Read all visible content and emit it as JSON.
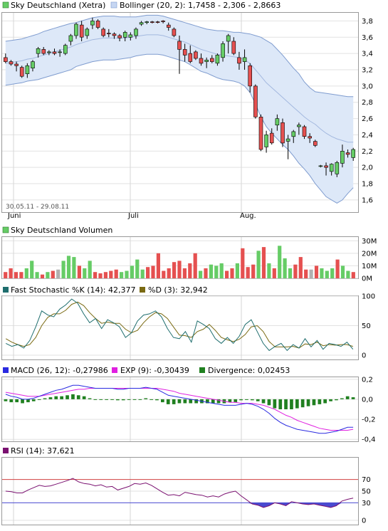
{
  "colors": {
    "up": "#66cc66",
    "down": "#e55050",
    "neutral": "#b0b0b0",
    "band_fill": "#dde8f8",
    "band_line": "#7f9ccf",
    "stoch_k": "#1f6e6e",
    "stoch_d": "#7a6a12",
    "macd": "#2a2ae0",
    "exp": "#e020e0",
    "divergence": "#208020",
    "rsi": "#7a1070",
    "rsi_over": "#4a4ad0",
    "overbought": "#d04040"
  },
  "price_panel": {
    "legend_primary": "Sky Deutschland (Xetra)",
    "legend_bollinger": "Bollinger (20, 2): 1,7458 - 2,306 - 2,8663",
    "date_range": "30.05.11 - 29.08.11",
    "month_labels": [
      "Juni",
      "Juli",
      "Aug."
    ],
    "y_ticks": [
      "3,8",
      "3,6",
      "3,4",
      "3,2",
      "3,0",
      "2,8",
      "2,6",
      "2,4",
      "2,2",
      "2,0",
      "1,8",
      "1,6"
    ]
  },
  "volume_panel": {
    "legend": "Sky Deutschland Volumen",
    "y_ticks": [
      "30M",
      "20M",
      "10M",
      "0M"
    ]
  },
  "stoch_panel": {
    "legend_k": "Fast Stochastic %K (14): 42,377",
    "legend_d": "%D (3): 32,942",
    "y_ticks": [
      "100",
      "50",
      "0"
    ]
  },
  "macd_panel": {
    "legend_macd": "MACD (26, 12): -0,27986",
    "legend_exp": "EXP (9): -0,30439",
    "legend_div": "Divergence: 0,02453",
    "y_ticks": [
      "0,2",
      "0,0",
      "-0,2",
      "-0,4"
    ]
  },
  "rsi_panel": {
    "legend": "RSI (14): 37,621",
    "y_ticks": [
      "70",
      "50",
      "30",
      "0"
    ]
  },
  "chart_data": [
    {
      "type": "candlestick",
      "title": "Sky Deutschland (Xetra)",
      "x": [
        "Jun",
        "Jun",
        "Jun",
        "Jun",
        "Jun",
        "Jun",
        "Jun",
        "Jun",
        "Jun",
        "Jun",
        "Jun",
        "Jun",
        "Jun",
        "Jun",
        "Jun",
        "Jun",
        "Jun",
        "Jun",
        "Jun",
        "Jun",
        "Jun",
        "Jun",
        "Jul",
        "Jul",
        "Jul",
        "Jul",
        "Jul",
        "Jul",
        "Jul",
        "Jul",
        "Jul",
        "Jul",
        "Jul",
        "Jul",
        "Jul",
        "Jul",
        "Jul",
        "Jul",
        "Jul",
        "Jul",
        "Jul",
        "Jul",
        "Jul",
        "Aug",
        "Aug",
        "Aug",
        "Aug",
        "Aug",
        "Aug",
        "Aug",
        "Aug",
        "Aug",
        "Aug",
        "Aug",
        "Aug",
        "Aug",
        "Aug",
        "Aug",
        "Aug",
        "Aug",
        "Aug",
        "Aug",
        "Aug",
        "Aug",
        "Aug"
      ],
      "ohlc": [
        [
          3.35,
          3.4,
          3.28,
          3.3
        ],
        [
          3.3,
          3.32,
          3.25,
          3.27
        ],
        [
          3.27,
          3.3,
          3.18,
          3.25
        ],
        [
          3.23,
          3.25,
          3.1,
          3.12
        ],
        [
          3.15,
          3.28,
          3.1,
          3.25
        ],
        [
          3.22,
          3.32,
          3.18,
          3.3
        ],
        [
          3.4,
          3.48,
          3.35,
          3.46
        ],
        [
          3.45,
          3.48,
          3.38,
          3.4
        ],
        [
          3.41,
          3.44,
          3.38,
          3.42
        ],
        [
          3.42,
          3.46,
          3.38,
          3.4
        ],
        [
          3.42,
          3.45,
          3.36,
          3.42
        ],
        [
          3.4,
          3.52,
          3.38,
          3.5
        ],
        [
          3.55,
          3.64,
          3.5,
          3.62
        ],
        [
          3.62,
          3.78,
          3.58,
          3.76
        ],
        [
          3.75,
          3.8,
          3.55,
          3.6
        ],
        [
          3.62,
          3.72,
          3.58,
          3.7
        ],
        [
          3.75,
          3.84,
          3.7,
          3.8
        ],
        [
          3.8,
          3.82,
          3.7,
          3.72
        ],
        [
          3.7,
          3.72,
          3.6,
          3.62
        ],
        [
          3.65,
          3.7,
          3.6,
          3.64
        ],
        [
          3.64,
          3.66,
          3.58,
          3.62
        ],
        [
          3.62,
          3.64,
          3.55,
          3.59
        ],
        [
          3.6,
          3.68,
          3.55,
          3.66
        ],
        [
          3.6,
          3.66,
          3.56,
          3.63
        ],
        [
          3.62,
          3.72,
          3.58,
          3.7
        ],
        [
          3.76,
          3.8,
          3.74,
          3.78
        ],
        [
          3.78,
          3.8,
          3.76,
          3.79
        ],
        [
          3.79,
          3.8,
          3.77,
          3.78
        ],
        [
          3.79,
          3.8,
          3.77,
          3.78
        ],
        [
          3.8,
          3.81,
          3.77,
          3.79
        ],
        [
          3.75,
          3.78,
          3.68,
          3.72
        ],
        [
          3.7,
          3.72,
          3.6,
          3.62
        ],
        [
          3.55,
          3.62,
          3.15,
          3.45
        ],
        [
          3.45,
          3.52,
          3.3,
          3.38
        ],
        [
          3.4,
          3.5,
          3.28,
          3.3
        ],
        [
          3.42,
          3.44,
          3.32,
          3.34
        ],
        [
          3.34,
          3.4,
          3.25,
          3.28
        ],
        [
          3.3,
          3.35,
          3.22,
          3.32
        ],
        [
          3.34,
          3.38,
          3.28,
          3.3
        ],
        [
          3.28,
          3.4,
          3.25,
          3.38
        ],
        [
          3.35,
          3.55,
          3.3,
          3.52
        ],
        [
          3.55,
          3.64,
          3.4,
          3.62
        ],
        [
          3.55,
          3.6,
          3.38,
          3.4
        ],
        [
          3.35,
          3.42,
          3.2,
          3.28
        ],
        [
          3.3,
          3.45,
          3.2,
          3.35
        ],
        [
          3.25,
          3.28,
          2.92,
          3.0
        ],
        [
          3.0,
          3.02,
          2.6,
          2.62
        ],
        [
          2.62,
          2.65,
          2.2,
          2.22
        ],
        [
          2.25,
          2.45,
          2.18,
          2.4
        ],
        [
          2.42,
          2.48,
          2.28,
          2.3
        ],
        [
          2.52,
          2.65,
          2.45,
          2.6
        ],
        [
          2.55,
          2.6,
          2.25,
          2.3
        ],
        [
          2.32,
          2.4,
          2.1,
          2.35
        ],
        [
          2.38,
          2.46,
          2.3,
          2.44
        ],
        [
          2.5,
          2.55,
          2.4,
          2.52
        ],
        [
          2.5,
          2.52,
          2.35,
          2.38
        ],
        [
          2.38,
          2.42,
          2.3,
          2.36
        ],
        [
          2.32,
          2.34,
          2.25,
          2.27
        ],
        [
          2.02,
          2.03,
          2.0,
          2.02
        ],
        [
          2.02,
          2.06,
          1.9,
          2.0
        ],
        [
          1.95,
          2.05,
          1.9,
          2.04
        ],
        [
          1.92,
          2.08,
          1.88,
          2.06
        ],
        [
          2.05,
          2.28,
          2.0,
          2.2
        ],
        [
          2.18,
          2.22,
          2.12,
          2.16
        ],
        [
          2.12,
          2.24,
          2.08,
          2.22
        ]
      ],
      "bollinger": {
        "upper": [
          3.55,
          3.56,
          3.57,
          3.58,
          3.6,
          3.62,
          3.64,
          3.67,
          3.69,
          3.71,
          3.73,
          3.75,
          3.77,
          3.78,
          3.8,
          3.82,
          3.84,
          3.85,
          3.86,
          3.86,
          3.86,
          3.85,
          3.85,
          3.85,
          3.85,
          3.86,
          3.87,
          3.87,
          3.87,
          3.86,
          3.84,
          3.82,
          3.8,
          3.78,
          3.76,
          3.74,
          3.72,
          3.7,
          3.69,
          3.68,
          3.68,
          3.67,
          3.66,
          3.66,
          3.65,
          3.64,
          3.62,
          3.6,
          3.56,
          3.52,
          3.45,
          3.38,
          3.3,
          3.22,
          3.15,
          3.05,
          2.98,
          2.93,
          2.92,
          2.91,
          2.9,
          2.89,
          2.88,
          2.87,
          2.87
        ],
        "middle": [
          3.28,
          3.29,
          3.3,
          3.31,
          3.33,
          3.34,
          3.36,
          3.38,
          3.4,
          3.42,
          3.44,
          3.46,
          3.48,
          3.51,
          3.53,
          3.55,
          3.57,
          3.58,
          3.59,
          3.59,
          3.59,
          3.59,
          3.59,
          3.6,
          3.61,
          3.62,
          3.63,
          3.63,
          3.63,
          3.62,
          3.6,
          3.58,
          3.56,
          3.54,
          3.51,
          3.48,
          3.45,
          3.43,
          3.41,
          3.39,
          3.38,
          3.37,
          3.36,
          3.35,
          3.32,
          3.28,
          3.2,
          3.12,
          3.04,
          2.98,
          2.92,
          2.86,
          2.8,
          2.74,
          2.68,
          2.62,
          2.57,
          2.53,
          2.47,
          2.42,
          2.38,
          2.35,
          2.33,
          2.31,
          2.31
        ],
        "lower": [
          3.01,
          3.02,
          3.03,
          3.04,
          3.06,
          3.07,
          3.08,
          3.1,
          3.12,
          3.14,
          3.16,
          3.18,
          3.2,
          3.24,
          3.26,
          3.28,
          3.3,
          3.31,
          3.32,
          3.32,
          3.32,
          3.33,
          3.34,
          3.35,
          3.37,
          3.38,
          3.39,
          3.39,
          3.39,
          3.38,
          3.36,
          3.34,
          3.32,
          3.3,
          3.26,
          3.22,
          3.18,
          3.16,
          3.13,
          3.1,
          3.08,
          3.07,
          3.06,
          3.04,
          3.0,
          2.92,
          2.78,
          2.62,
          2.5,
          2.42,
          2.35,
          2.28,
          2.22,
          2.14,
          2.05,
          1.98,
          1.9,
          1.8,
          1.72,
          1.64,
          1.6,
          1.56,
          1.6,
          1.68,
          1.75
        ]
      },
      "y_range": [
        1.45,
        3.9
      ]
    },
    {
      "type": "bar",
      "title": "Sky Deutschland Volumen",
      "values": [
        5,
        8,
        5,
        5,
        8,
        14,
        5,
        3,
        5,
        6,
        7,
        14,
        18,
        17,
        10,
        8,
        14,
        5,
        4,
        5,
        6,
        7,
        5,
        6,
        10,
        15,
        7,
        9,
        10,
        20,
        6,
        8,
        13,
        14,
        8,
        12,
        20,
        6,
        8,
        11,
        10,
        12,
        6,
        8,
        12,
        24,
        9,
        11,
        22,
        25,
        12,
        8,
        26,
        16,
        8,
        11,
        17,
        7,
        7,
        10,
        8,
        6,
        8,
        15,
        10,
        6,
        5
      ]
    },
    {
      "type": "line",
      "title": "Fast Stochastic",
      "series": [
        {
          "name": "%K",
          "values": [
            20,
            15,
            18,
            12,
            25,
            48,
            75,
            68,
            65,
            78,
            85,
            95,
            88,
            70,
            55,
            62,
            45,
            60,
            55,
            48,
            30,
            38,
            58,
            68,
            70,
            75,
            65,
            45,
            30,
            28,
            40,
            22,
            58,
            52,
            45,
            28,
            20,
            30,
            20,
            32,
            52,
            60,
            40,
            20,
            8,
            15,
            20,
            8,
            18,
            12,
            28,
            14,
            25,
            10,
            20,
            18,
            15,
            22,
            10
          ]
        },
        {
          "name": "%D",
          "values": [
            28,
            22,
            18,
            15,
            18,
            30,
            50,
            64,
            70,
            70,
            76,
            86,
            90,
            84,
            72,
            62,
            54,
            56,
            54,
            54,
            44,
            38,
            42,
            55,
            65,
            72,
            70,
            62,
            48,
            34,
            33,
            30,
            40,
            44,
            52,
            42,
            30,
            26,
            23,
            27,
            35,
            48,
            50,
            40,
            23,
            14,
            14,
            14,
            15,
            12,
            19,
            18,
            22,
            16,
            18,
            17,
            18,
            18,
            15
          ]
        }
      ],
      "y_range": [
        0,
        100
      ]
    },
    {
      "type": "line",
      "title": "MACD",
      "series": [
        {
          "name": "MACD",
          "values": [
            0.05,
            0.03,
            0.02,
            0.0,
            0.0,
            0.01,
            0.03,
            0.05,
            0.07,
            0.09,
            0.1,
            0.12,
            0.14,
            0.14,
            0.13,
            0.12,
            0.11,
            0.11,
            0.11,
            0.11,
            0.1,
            0.1,
            0.11,
            0.11,
            0.11,
            0.12,
            0.11,
            0.1,
            0.07,
            0.04,
            0.03,
            0.02,
            0.01,
            0.0,
            -0.01,
            -0.02,
            -0.03,
            -0.04,
            -0.05,
            -0.06,
            -0.06,
            -0.06,
            -0.05,
            -0.04,
            -0.05,
            -0.07,
            -0.1,
            -0.14,
            -0.19,
            -0.23,
            -0.26,
            -0.28,
            -0.3,
            -0.31,
            -0.32,
            -0.33,
            -0.34,
            -0.34,
            -0.33,
            -0.32,
            -0.3,
            -0.28,
            -0.28
          ]
        },
        {
          "name": "EXP",
          "values": [
            0.07,
            0.06,
            0.05,
            0.04,
            0.03,
            0.03,
            0.03,
            0.04,
            0.05,
            0.06,
            0.07,
            0.08,
            0.09,
            0.1,
            0.1,
            0.11,
            0.11,
            0.11,
            0.11,
            0.11,
            0.11,
            0.11,
            0.11,
            0.11,
            0.11,
            0.11,
            0.11,
            0.11,
            0.1,
            0.09,
            0.08,
            0.06,
            0.05,
            0.04,
            0.03,
            0.02,
            0.01,
            0.0,
            -0.01,
            -0.02,
            -0.03,
            -0.03,
            -0.04,
            -0.04,
            -0.04,
            -0.05,
            -0.06,
            -0.08,
            -0.1,
            -0.13,
            -0.16,
            -0.18,
            -0.21,
            -0.23,
            -0.25,
            -0.27,
            -0.29,
            -0.3,
            -0.31,
            -0.31,
            -0.31,
            -0.31,
            -0.3
          ]
        },
        {
          "name": "Divergence",
          "values": [
            -0.02,
            -0.03,
            -0.03,
            -0.04,
            -0.03,
            -0.02,
            0.0,
            0.01,
            0.02,
            0.03,
            0.03,
            0.04,
            0.05,
            0.04,
            0.03,
            0.01,
            0.0,
            0.0,
            0.0,
            0.0,
            -0.01,
            -0.01,
            0.0,
            0.0,
            0.0,
            0.01,
            0.0,
            -0.01,
            -0.03,
            -0.05,
            -0.05,
            -0.04,
            -0.04,
            -0.04,
            -0.04,
            -0.04,
            -0.04,
            -0.04,
            -0.04,
            -0.04,
            -0.03,
            -0.03,
            -0.01,
            0.0,
            -0.01,
            -0.02,
            -0.04,
            -0.06,
            -0.09,
            -0.1,
            -0.1,
            -0.1,
            -0.09,
            -0.08,
            -0.07,
            -0.06,
            -0.05,
            -0.04,
            -0.02,
            -0.01,
            0.01,
            0.03,
            0.02
          ]
        }
      ],
      "y_range": [
        -0.42,
        0.22
      ]
    },
    {
      "type": "line",
      "title": "RSI",
      "series": [
        {
          "name": "RSI",
          "values": [
            50,
            49,
            47,
            47,
            52,
            56,
            60,
            58,
            59,
            62,
            65,
            68,
            72,
            66,
            63,
            62,
            59,
            61,
            57,
            58,
            52,
            55,
            58,
            63,
            62,
            64,
            60,
            54,
            48,
            43,
            44,
            42,
            48,
            46,
            44,
            43,
            40,
            42,
            40,
            45,
            48,
            50,
            42,
            35,
            28,
            26,
            22,
            25,
            30,
            28,
            25,
            32,
            30,
            28,
            27,
            28,
            26,
            24,
            22,
            25,
            33,
            36,
            38
          ]
        }
      ],
      "y_range": [
        0,
        100
      ],
      "reference_lines": [
        70,
        30
      ]
    }
  ]
}
